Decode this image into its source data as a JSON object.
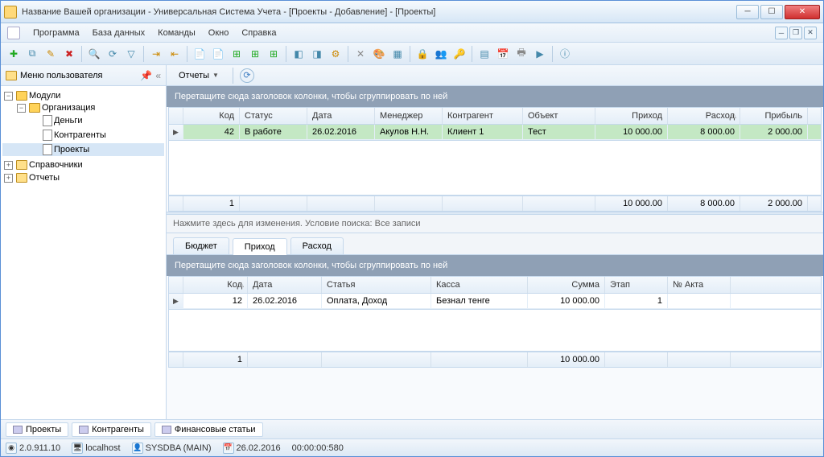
{
  "window": {
    "title": "Название Вашей организации - Универсальная Система Учета - [Проекты - Добавление] - [Проекты]"
  },
  "menus": [
    "Программа",
    "База данных",
    "Команды",
    "Окно",
    "Справка"
  ],
  "sidebar": {
    "userMenu": "Меню пользователя",
    "nodes": {
      "root": "Модули",
      "org": "Организация",
      "money": "Деньги",
      "contragents": "Контрагенты",
      "projects": "Проекты",
      "refs": "Справочники",
      "reports": "Отчеты"
    }
  },
  "subbar": {
    "reports": "Отчеты"
  },
  "topgrid": {
    "groupHint": "Перетащите сюда заголовок колонки, чтобы сгруппировать по ней",
    "cols": [
      "Код",
      "Статус",
      "Дата",
      "Менеджер",
      "Контрагент",
      "Объект",
      "Приход",
      "Расход",
      "Прибыль"
    ],
    "row": {
      "code": "42",
      "status": "В работе",
      "date": "26.02.2016",
      "manager": "Акулов Н.Н.",
      "contragent": "Клиент 1",
      "object": "Тест",
      "income": "10 000.00",
      "expense": "8 000.00",
      "profit": "2 000.00"
    },
    "sum": {
      "count": "1",
      "income": "10 000.00",
      "expense": "8 000.00",
      "profit": "2 000.00"
    }
  },
  "filter": {
    "text": "Нажмите здесь для изменения. Условие поиска: Все записи"
  },
  "tabs": [
    "Бюджет",
    "Приход",
    "Расход"
  ],
  "bottomgrid": {
    "groupHint": "Перетащите сюда заголовок колонки, чтобы сгруппировать по ней",
    "cols": [
      "Код",
      "Дата",
      "Статья",
      "Касса",
      "Сумма",
      "Этап",
      "№ Акта"
    ],
    "row": {
      "code": "12",
      "date": "26.02.2016",
      "article": "Оплата, Доход",
      "kassa": "Безнал тенге",
      "sum": "10 000.00",
      "stage": "1",
      "act": ""
    },
    "sum": {
      "count": "1",
      "sum": "10 000.00"
    }
  },
  "bottomTabs": [
    "Проекты",
    "Контрагенты",
    "Финансовые статьи"
  ],
  "statusbar": {
    "version": "2.0.911.10",
    "host": "localhost",
    "user": "SYSDBA (MAIN)",
    "date": "26.02.2016",
    "timer": "00:00:00:580"
  }
}
